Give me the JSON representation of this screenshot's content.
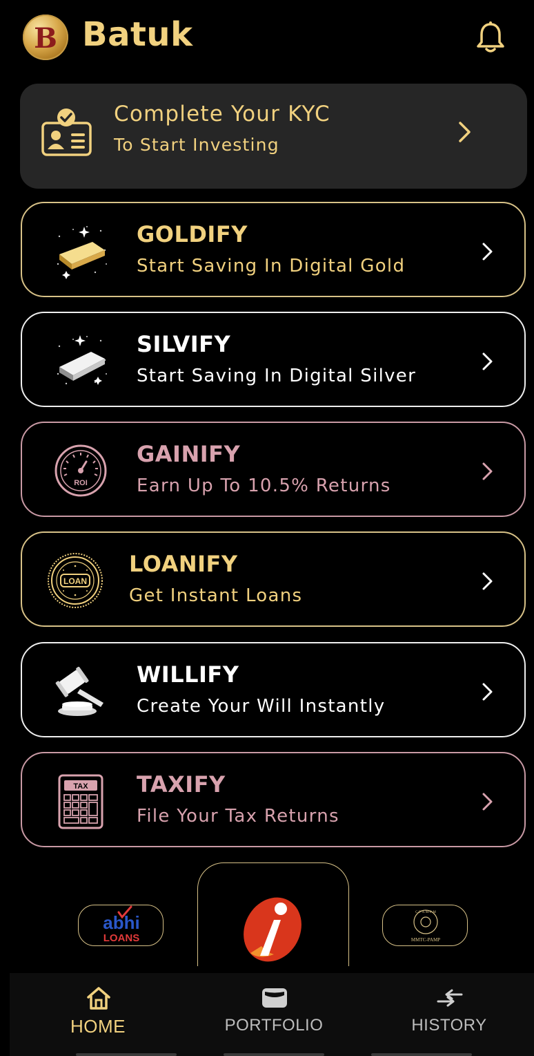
{
  "header": {
    "brand": "Batuk",
    "logo_letter": "B"
  },
  "kyc": {
    "title": "Complete Your KYC",
    "subtitle": "To Start Investing"
  },
  "products": [
    {
      "title": "GOLDIFY",
      "subtitle": "Start Saving In Digital Gold",
      "icon": "gold-bar-icon"
    },
    {
      "title": "SILVIFY",
      "subtitle": "Start Saving In Digital Silver",
      "icon": "silver-bar-icon"
    },
    {
      "title": "GAINIFY",
      "subtitle": "Earn Up To 10.5% Returns",
      "icon": "roi-gauge-icon",
      "icon_text": "ROI"
    },
    {
      "title": "LOANIFY",
      "subtitle": "Get Instant Loans",
      "icon": "loan-badge-icon",
      "icon_text": "LOAN"
    },
    {
      "title": "WILLIFY",
      "subtitle": "Create Your Will Instantly",
      "icon": "gavel-icon"
    },
    {
      "title": "TAXIFY",
      "subtitle": "File Your Tax Returns",
      "icon": "tax-calculator-icon",
      "icon_text": "TAX"
    }
  ],
  "partners": {
    "left": {
      "line1": "abhi",
      "line2": "LOANS"
    },
    "center": {
      "name": "ICICI i logo"
    },
    "right": {
      "line1": "MMTC-PAMP",
      "seal_text": "C·P·A·M·P·M"
    }
  },
  "nav": [
    {
      "label": "HOME",
      "icon": "home-icon",
      "active": true
    },
    {
      "label": "PORTFOLIO",
      "icon": "wallet-icon",
      "active": false
    },
    {
      "label": "HISTORY",
      "icon": "swap-arrows-icon",
      "active": false
    }
  ],
  "colors": {
    "gold": "#f1d17f",
    "card_bg": "#262626",
    "rose": "#d8a2ae",
    "white": "#ffffff",
    "background": "#000000"
  }
}
